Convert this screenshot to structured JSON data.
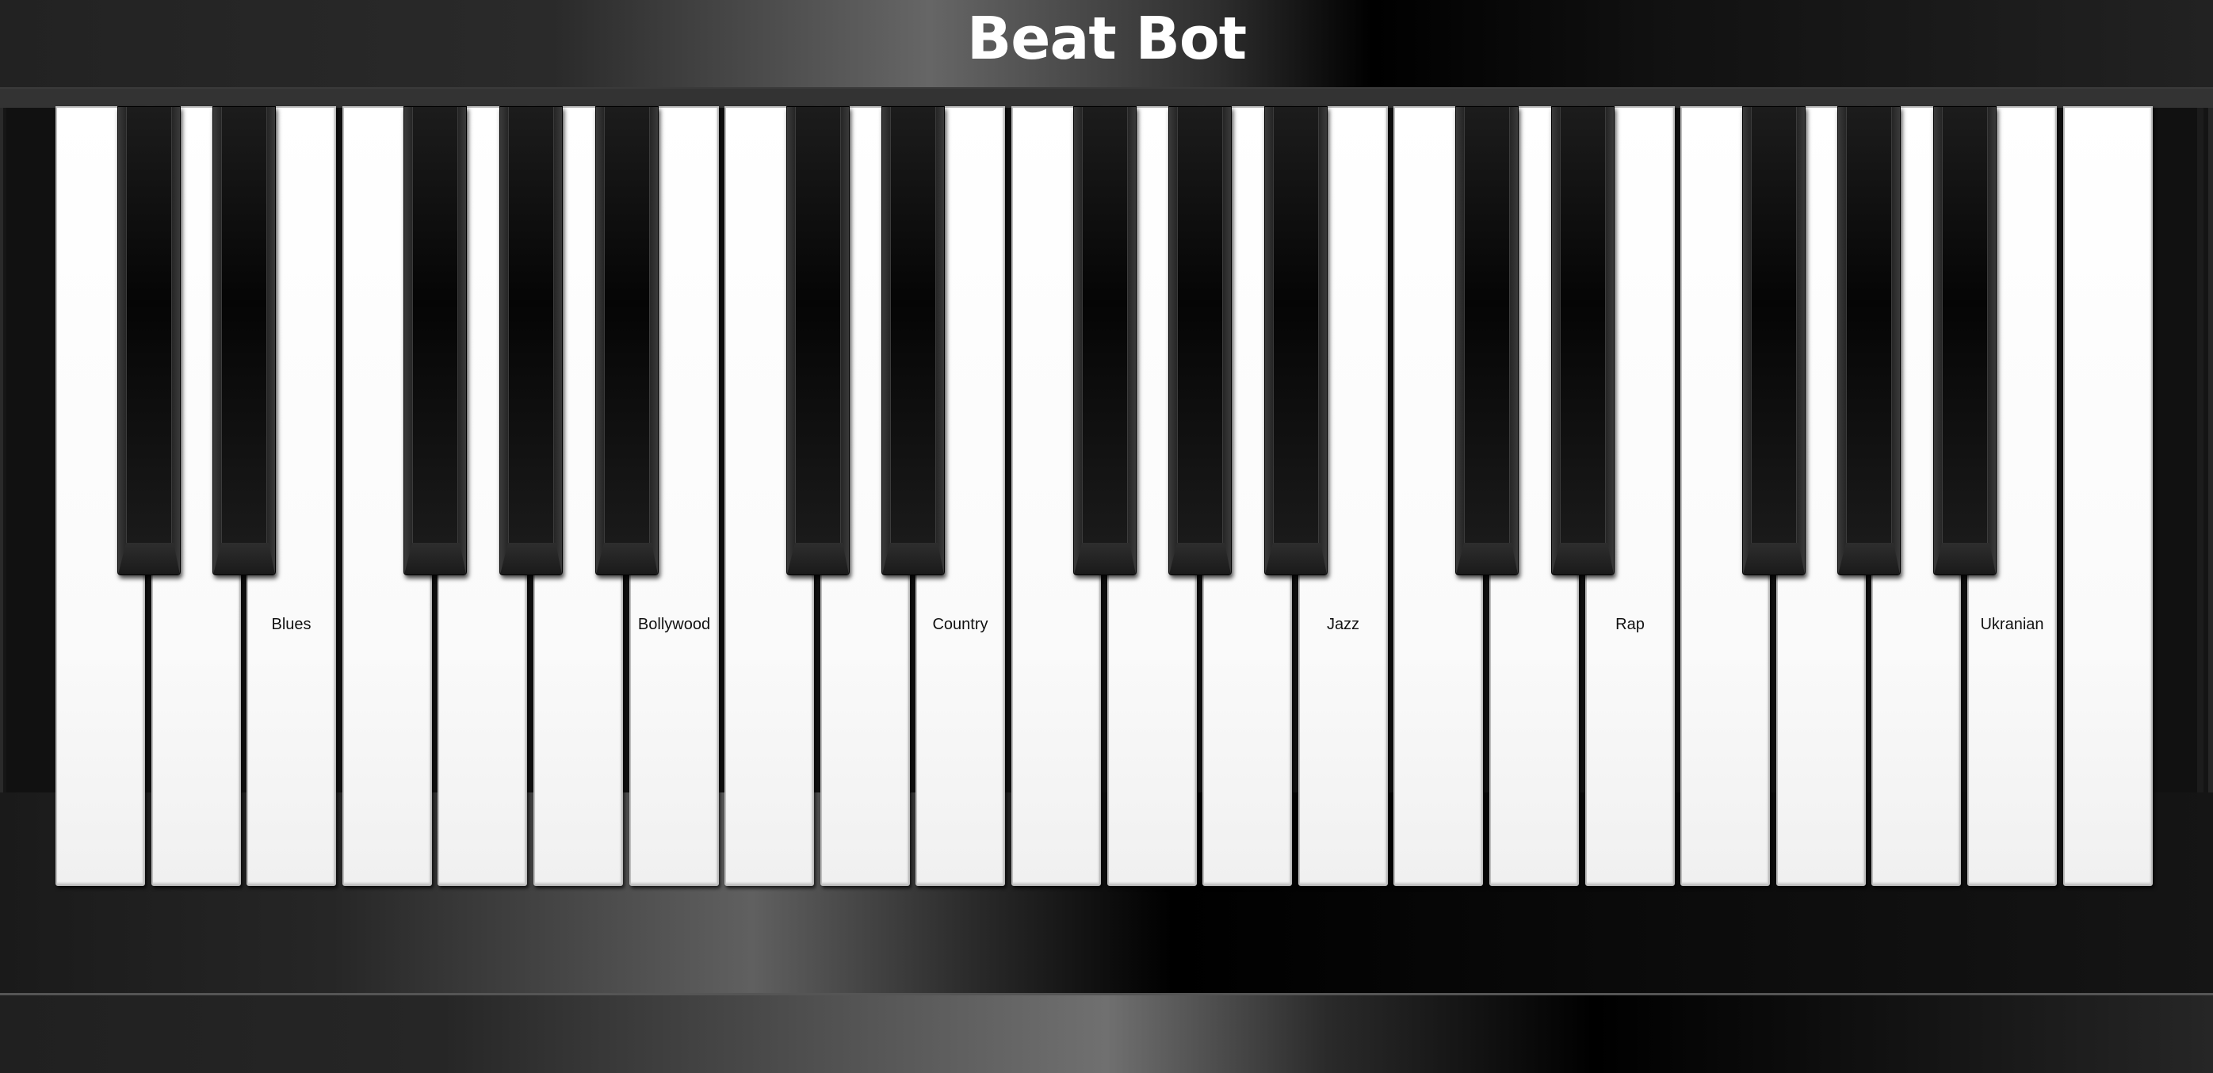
{
  "app": {
    "title": "Beat Bot"
  },
  "keyboard": {
    "white_key_count": 22,
    "black_key_count": 15,
    "labels": [
      {
        "key_index": 2,
        "text": "Blues"
      },
      {
        "key_index": 6,
        "text": "Bollywood"
      },
      {
        "key_index": 9,
        "text": "Country"
      },
      {
        "key_index": 13,
        "text": "Jazz"
      },
      {
        "key_index": 16,
        "text": "Rap"
      },
      {
        "key_index": 20,
        "text": "Ukranian"
      }
    ],
    "black_key_after_white": [
      0,
      1,
      3,
      4,
      5,
      7,
      8,
      10,
      11,
      12,
      14,
      15,
      17,
      18,
      19
    ]
  },
  "colors": {
    "white_key": "#fafafa",
    "black_key": "#050505",
    "title_text": "#ffffff"
  }
}
